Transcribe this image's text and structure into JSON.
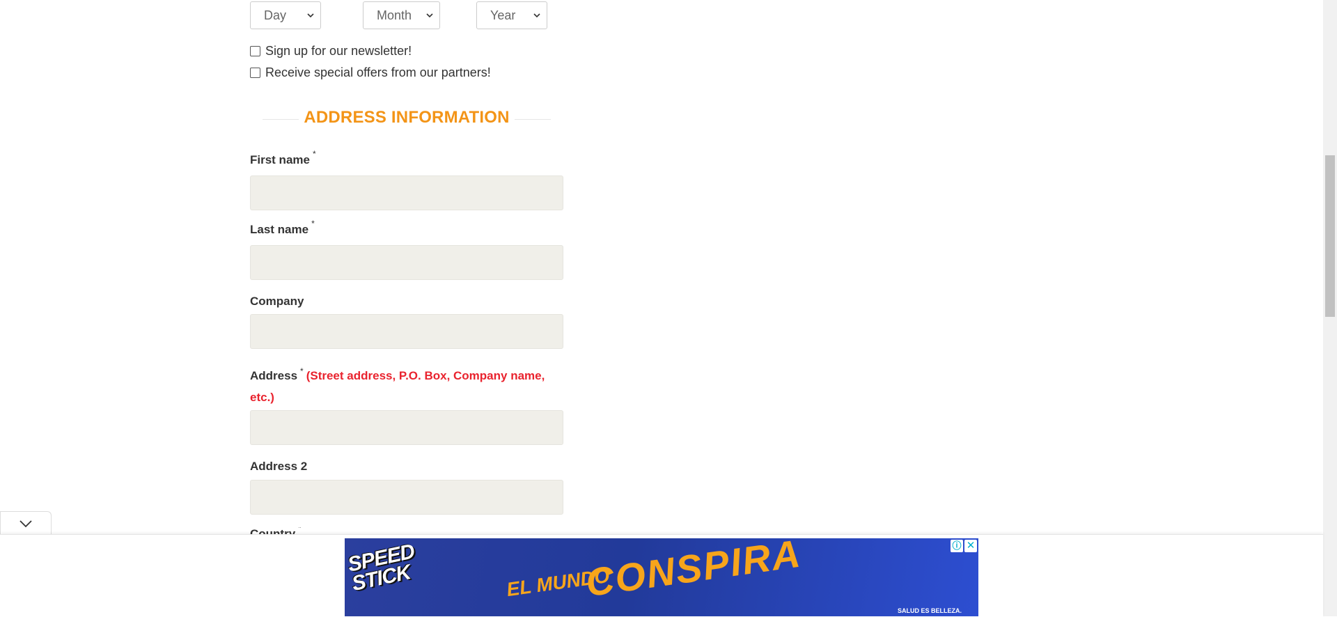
{
  "birthdate": {
    "day": "Day",
    "month": "Month",
    "year": "Year"
  },
  "newsletter": {
    "signup_label": "Sign up for our newsletter!",
    "offers_label": "Receive special offers from our partners!"
  },
  "address_section": {
    "title": "ADDRESS INFORMATION",
    "required_mark": "*",
    "first_name_label": "First name",
    "last_name_label": "Last name",
    "company_label": "Company",
    "address_label": "Address",
    "address_hint": "(Street address, P.O. Box, Company name, etc.)",
    "address2_label": "Address 2",
    "country_label": "Country"
  },
  "ad": {
    "brand": "SPEED STICK",
    "headline_small": "EL MUNDO",
    "headline_big": "CONSPIRA",
    "tagline": "SALUD ES BELLEZA.",
    "info_icon": "info-icon",
    "close_icon": "close-icon"
  },
  "colors": {
    "accent": "#f39417",
    "hint_red": "#e9232e",
    "field_bg": "#f0efe9"
  }
}
